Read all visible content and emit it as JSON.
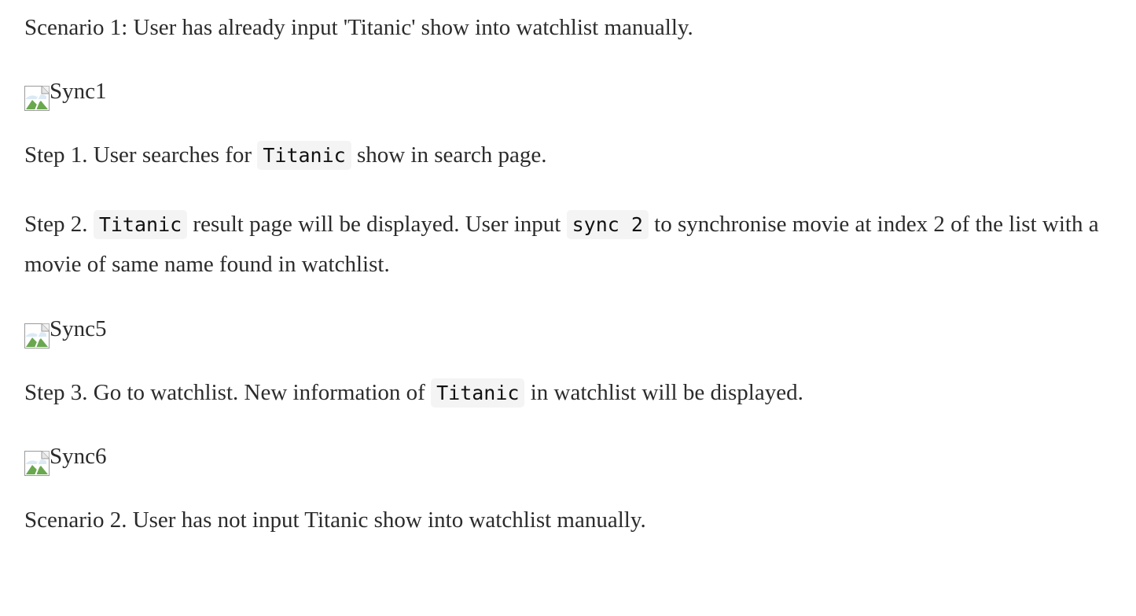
{
  "paragraphs": {
    "scenario1": "Scenario 1: User has already input 'Titanic' show into watchlist manually.",
    "step1": {
      "before": "Step 1. User searches for ",
      "code": "Titanic",
      "after": " show in search page."
    },
    "step2": {
      "before": "Step 2. ",
      "code1": "Titanic",
      "middle": " result page will be displayed. User input ",
      "code2": "sync 2",
      "after": " to synchronise movie at index 2 of the list with a movie of same name found in watchlist."
    },
    "step3": {
      "before": "Step 3. Go to watchlist. New information of ",
      "code": "Titanic",
      "after": " in watchlist will be displayed."
    },
    "scenario2": "Scenario 2. User has not input Titanic show into watchlist manually."
  },
  "images": [
    {
      "alt": "Sync1",
      "icon": "broken-image-icon"
    },
    {
      "alt": "Sync5",
      "icon": "broken-image-icon"
    },
    {
      "alt": "Sync6",
      "icon": "broken-image-icon"
    }
  ]
}
